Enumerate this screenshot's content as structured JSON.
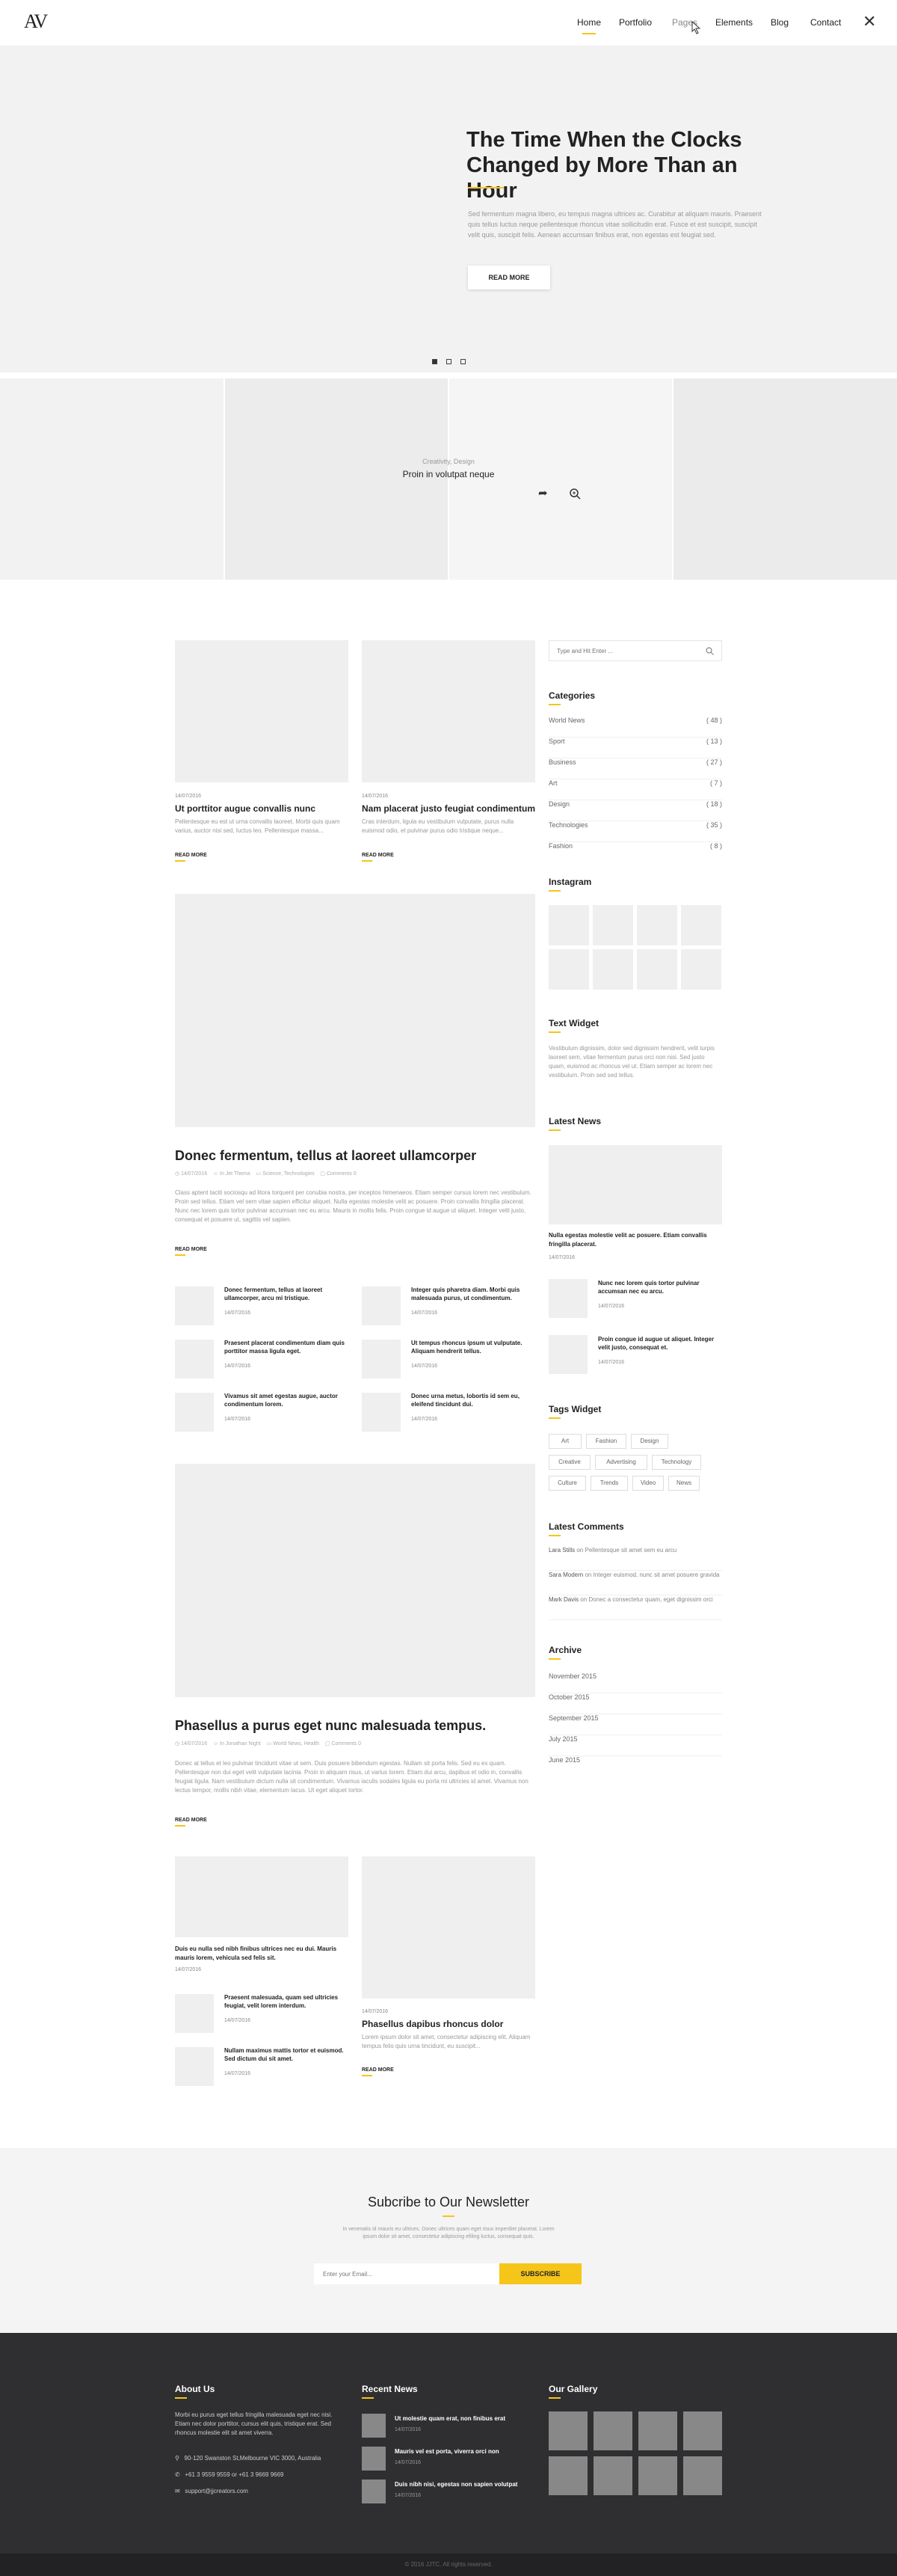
{
  "header": {
    "logo": "AV",
    "nav": [
      "Home",
      "Portfolio",
      "Pages",
      "Elements",
      "Blog",
      "Contact"
    ],
    "close_icon": "close-icon"
  },
  "slider": {
    "title": "The Time When the Clocks Changed by More Than an Hour",
    "text": "Sed fermentum magna libero, eu tempus magna ultrices ac. Curabitur at aliquam mauris. Praesent quis tellus luctus neque pellentesque rhoncus vitae sollicitudin erat. Fusce et est suscipit, suscipit velit quis, suscipit felis. Aenean accumsan finibus erat, non egestas est feugiat sed.",
    "button": "READ MORE",
    "active_slide": 1,
    "slide_count": 3
  },
  "portfolio": {
    "category": "Creativity, Design",
    "title": "Proin in volutpat neque"
  },
  "posts_top": [
    {
      "date": "14/07/2016",
      "title": "Ut porttitor augue convallis nunc",
      "excerpt": "Pellentesque eu est ut urna convallis laoreet. Morbi quis quam varius, auctor nisi sed, luctus leo. Pellentesque massa...",
      "read_more": "READ MORE"
    },
    {
      "date": "14/07/2016",
      "title": "Nam placerat justo feugiat condimentum",
      "excerpt": "Cras interdum, ligula eu vestibulum vulputate, purus nulla euismod odio, et pulvinar purus odio tristique neque...",
      "read_more": "READ MORE"
    }
  ],
  "featured_1": {
    "title": "Donec fermentum, tellus at laoreet ullamcorper",
    "date": "14/07/2016",
    "author": "In Jet Thema",
    "category": "Science, Technologies",
    "comments": "Comments 0",
    "excerpt": "Class aptent taciti sociosqu ad litora torquent per conubia nostra, per inceptos himenaeos. Etiam semper cursus lorem nec vestibulum. Proin sed tellus. Etiam vel sem vitae sapien efficitur aliquet. Nulla egestas molestie velit ac posuere. Proin convallis fringilla placerat. Nunc nec lorem quis tortor pulvinar accumsan nec eu arcu. Mauris in mollis felis. Proin congue id augue ut aliquet. Integer velit justo, consequat et posuere ut, sagittis vel sapien.",
    "read_more": "READ MORE"
  },
  "mini_posts": [
    {
      "title": "Donec fermentum, tellus at laoreet ullamcorper, arcu mi tristique.",
      "date": "14/07/2016"
    },
    {
      "title": "Integer quis pharetra diam. Morbi quis malesuada purus, ut condimentum.",
      "date": "14/07/2016"
    },
    {
      "title": "Praesent placerat condimentum diam quis porttitor massa ligula eget.",
      "date": "14/07/2016"
    },
    {
      "title": "Ut tempus rhoncus ipsum ut vulputate. Aliquam hendrerit tellus.",
      "date": "14/07/2016"
    },
    {
      "title": "Vivamus sit amet egestas augue, auctor condimentum lorem.",
      "date": "14/07/2016"
    },
    {
      "title": "Donec urna metus, lobortis id sem eu, eleifend tincidunt dui.",
      "date": "14/07/2016"
    }
  ],
  "featured_2": {
    "title": "Phasellus a purus eget nunc malesuada tempus.",
    "date": "14/07/2016",
    "author": "In Jonathan Night",
    "category": "World News, Health",
    "comments": "Comments 0",
    "excerpt": "Donec at tellus et leo pulvinar tincidunt vitae ut sem. Duis posuere bibendum egestas. Nullam sit porta felis. Sed eu ex quam. Pellentesque non dui eget velit vulputate lacinia. Proin in aliquam risus, ut varius lorem. Etiam dui arcu, dapibus et odio in, convallis feugiat ligula. Nam vestibulum dictum nulla sit condimentum. Vivamus iaculis sodales ligula eu porta mi ultricies id amet. Vivamus non lectus tempor, mollis nibh vitae, elementum lacus. Ut eget aliquet tortor.",
    "read_more": "READ MORE"
  },
  "bottom_left": {
    "quote_title": "Duis eu nulla sed nibh finibus ultrices nec eu dui. Mauris mauris lorem, vehicula sed felis sit.",
    "quote_date": "14/07/2016",
    "items": [
      {
        "title": "Praesent malesuada, quam sed ultricies feugiat, velit lorem interdum.",
        "date": "14/07/2016"
      },
      {
        "title": "Nullam maximus mattis tortor et euismod. Sed dictum dui sit amet.",
        "date": "14/07/2016"
      }
    ]
  },
  "bottom_right": {
    "date": "14/07/2016",
    "title": "Phasellus dapibus rhoncus dolor",
    "excerpt": "Lorem ipsum dolor sit amet, consectetur adipiscing elit. Aliquam tempus felis quis urna tincidunt, eu suscipit...",
    "read_more": "READ MORE"
  },
  "sidebar": {
    "search_placeholder": "Type and Hit Enter ...",
    "categories_title": "Categories",
    "categories": [
      {
        "name": "World News",
        "count": "( 48 )"
      },
      {
        "name": "Sport",
        "count": "( 13 )"
      },
      {
        "name": "Business",
        "count": "( 27 )"
      },
      {
        "name": "Art",
        "count": "( 7 )"
      },
      {
        "name": "Design",
        "count": "( 18 )"
      },
      {
        "name": "Technologies",
        "count": "( 35 )"
      },
      {
        "name": "Fashion",
        "count": "( 8 )"
      }
    ],
    "instagram_title": "Instagram",
    "text_widget_title": "Text Widget",
    "text_widget": "Vestibulum dignissim, dolor sed dignissim hendrerit, velit turpis laoreet sem, vitae fermentum purus orci non nisi. Sed justo quam, euismod ac rhoncus vel ut. Etiam semper ac lorem nec vestibulum. Proin sed sed tellus.",
    "latest_news_title": "Latest News",
    "latest_main": {
      "title": "Nulla egestas molestie velit ac posuere. Etiam convallis fringilla placerat.",
      "date": "14/07/2016"
    },
    "latest_items": [
      {
        "title": "Nunc nec lorem quis tortor pulvinar accumsan nec eu arcu.",
        "date": "14/07/2016"
      },
      {
        "title": "Proin congue id augue ut aliquet. Integer velit justo, consequat et.",
        "date": "14/07/2016"
      }
    ],
    "tags_title": "Tags Widget",
    "tags": [
      "Art",
      "Fashion",
      "Design",
      "Creative",
      "Advertising",
      "Technology",
      "Culture",
      "Trends",
      "Video",
      "News"
    ],
    "comments_title": "Latest Comments",
    "comments": [
      {
        "author": "Lara Stills",
        "on": "on",
        "post": "Pellentesque sit amet sem eu arcu"
      },
      {
        "author": "Sara Modern",
        "on": "on",
        "post": "Integer euismod, nunc sit amet posuere gravida"
      },
      {
        "author": "Mark Davis",
        "on": "on",
        "post": "Donec a consectetur quam, eget dignissim orci"
      }
    ],
    "archive_title": "Archive",
    "archive": [
      "November 2015",
      "October 2015",
      "September 2015",
      "July 2015",
      "June 2015"
    ]
  },
  "newsletter": {
    "title": "Subcribe to Our Newsletter",
    "text": "In venenatis id mauris eu ultrices. Donec ultrices quam eget risus imperdiet placerat. Lorem ipsum dolor sit amet, consectetur adipiscing efiling luctus, consequat quis.",
    "placeholder": "Enter your Email...",
    "button": "SUBSCRIBE"
  },
  "footer": {
    "about_title": "About Us",
    "about_text": "Morbi eu purus eget tellus fringilla malesuada eget nec nisi. Etiam nec dolor porttitor, cursus elit quis, tristique erat. Sed rhoncus molestie elit sit amet viverra.",
    "address": "90-120 Swanston St,Melbourne VIC 3000, Australia",
    "phone": "+61 3 9559 9559 or +61 3 9669 9669",
    "email": "support@jjcreators.com",
    "recent_title": "Recent News",
    "recent": [
      {
        "title": "Ut molestie quam erat, non finibus erat",
        "date": "14/07/2016"
      },
      {
        "title": "Mauris vel est porta, viverra orci non",
        "date": "14/07/2016"
      },
      {
        "title": "Duis nibh nisi, egestas non sapien volutpat",
        "date": "14/07/2016"
      }
    ],
    "gallery_title": "Our Gallery",
    "copyright": "© 2016 JJTC. All rights reserved."
  },
  "colors": {
    "accent": "#f5c51a",
    "footer_bg": "#2f2f31",
    "placeholder": "#efefef"
  }
}
